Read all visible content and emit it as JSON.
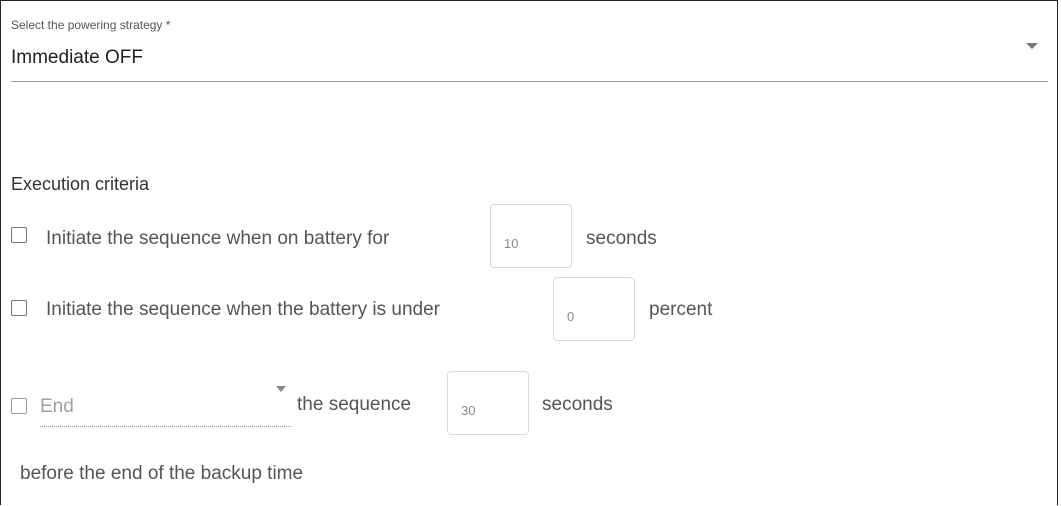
{
  "strategy": {
    "label": "Select the powering strategy *",
    "value": "Immediate OFF",
    "arrow_icon": "caret-down-icon"
  },
  "criteria": {
    "title": "Execution criteria",
    "battery_time": {
      "checked": false,
      "text": "Initiate the sequence when on battery for",
      "value": "10",
      "unit": "seconds"
    },
    "battery_level": {
      "checked": false,
      "text": "Initiate the sequence when the battery is under",
      "value": "0",
      "unit": "percent"
    },
    "end_sequence": {
      "checked": false,
      "select_value": "End",
      "text": "the sequence",
      "value": "30",
      "unit": "seconds",
      "suffix": "before the end of the backup time"
    }
  }
}
